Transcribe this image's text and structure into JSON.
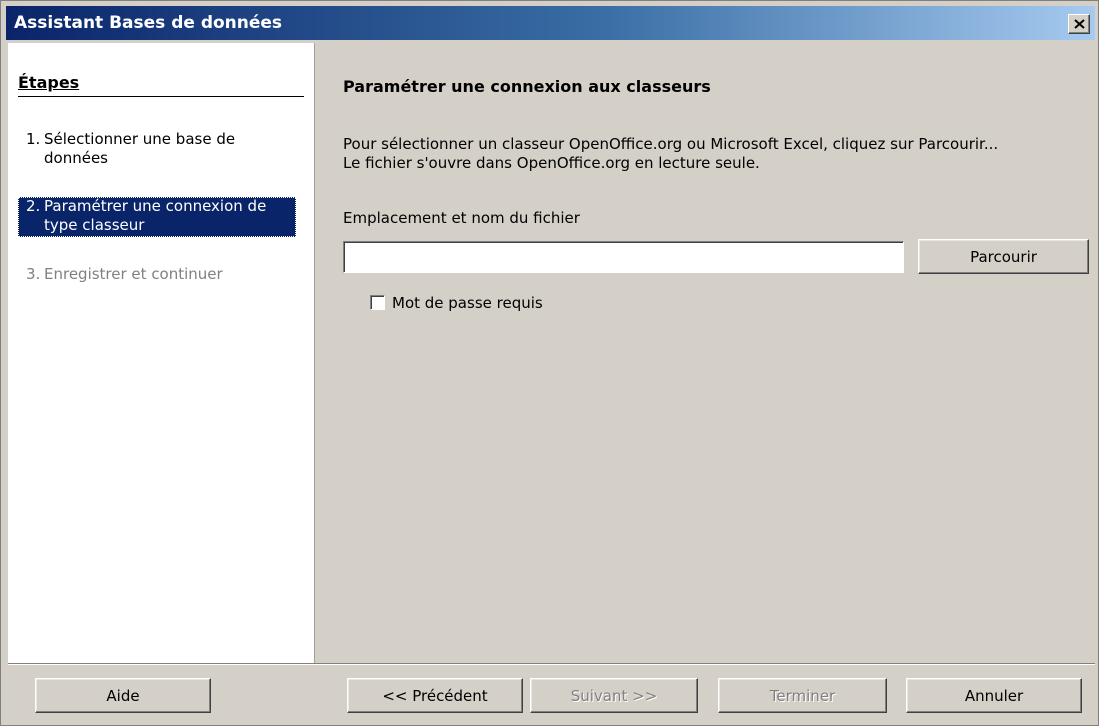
{
  "window": {
    "title": "Assistant Bases de données",
    "close_icon": "close-icon"
  },
  "steps": {
    "title": "Étapes",
    "items": [
      {
        "number": "1.",
        "label": "Sélectionner une base de données",
        "state": "done"
      },
      {
        "number": "2.",
        "label": "Paramétrer une connexion de type classeur",
        "state": "current"
      },
      {
        "number": "3.",
        "label": "Enregistrer et continuer",
        "state": "disabled"
      }
    ]
  },
  "page": {
    "title": "Paramétrer une connexion aux classeurs",
    "description_line1": "Pour sélectionner un classeur OpenOffice.org ou Microsoft Excel, cliquez sur Parcourir...",
    "description_line2": "Le fichier s'ouvre dans OpenOffice.org en lecture seule.",
    "location_label": "Emplacement et nom du fichier",
    "location_value": "",
    "browse_label": "Parcourir",
    "password_label": "Mot de passe requis",
    "password_checked": false
  },
  "footer": {
    "help_label": "Aide",
    "prev_label": "<< Précédent",
    "next_label": "Suivant >>",
    "finish_label": "Terminer",
    "cancel_label": "Annuler"
  },
  "colors": {
    "titlebar_start": "#0a246a",
    "titlebar_end": "#a6caf0",
    "selection": "#0a246a",
    "face": "#d4d0c8",
    "disabled_text": "#808080"
  }
}
